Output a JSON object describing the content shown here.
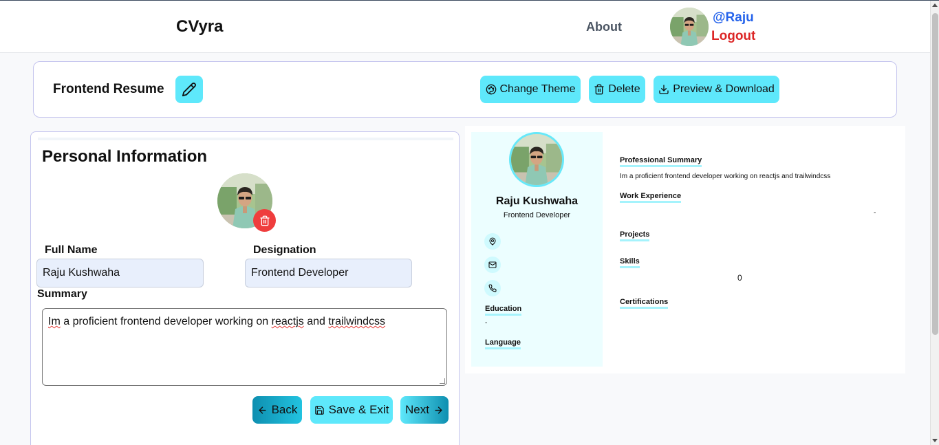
{
  "nav": {
    "brand": "CVyra",
    "about": "About",
    "username": "@Raju",
    "logout": "Logout"
  },
  "toolbar": {
    "resume_title": "Frontend Resume",
    "change_theme": "Change Theme",
    "delete": "Delete",
    "preview_download": "Preview & Download"
  },
  "form": {
    "title": "Personal Information",
    "full_name_label": "Full Name",
    "full_name_value": "Raju Kushwaha",
    "designation_label": "Designation",
    "designation_value": "Frontend Developer",
    "summary_label": "Summary",
    "summary_parts": [
      "Im",
      " a proficient frontend developer working on ",
      "reactjs",
      " and ",
      "trailwindcss"
    ],
    "back": "Back",
    "save_exit": "Save & Exit",
    "next": "Next"
  },
  "preview": {
    "name": "Raju Kushwaha",
    "role": "Frontend Developer",
    "education_heading": "Education",
    "education_value": "-",
    "language_heading": "Language",
    "summary_heading": "Professional Summary",
    "summary_text": "Im a proficient frontend developer working on reactjs and trailwindcss",
    "work_heading": "Work Experience",
    "work_value": "-",
    "projects_heading": "Projects",
    "skills_heading": "Skills",
    "skills_value": "0",
    "certifications_heading": "Certifications"
  },
  "colors": {
    "accent": "#5ee8fb",
    "username": "#2563eb",
    "logout": "#dc2626",
    "danger": "#ef3d3d",
    "preview_sidebar": "#ecfeff"
  },
  "icons": [
    "pencil-icon",
    "palette-icon",
    "trash-icon",
    "download-icon",
    "map-pin-icon",
    "mail-icon",
    "phone-icon",
    "arrow-left-icon",
    "save-icon",
    "arrow-right-icon"
  ]
}
